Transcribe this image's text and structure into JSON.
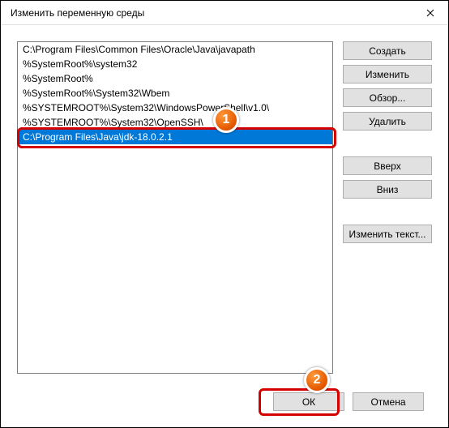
{
  "window": {
    "title": "Изменить переменную среды"
  },
  "list": {
    "items": [
      "C:\\Program Files\\Common Files\\Oracle\\Java\\javapath",
      "%SystemRoot%\\system32",
      "%SystemRoot%",
      "%SystemRoot%\\System32\\Wbem",
      "%SYSTEMROOT%\\System32\\WindowsPowerShell\\v1.0\\",
      "%SYSTEMROOT%\\System32\\OpenSSH\\"
    ],
    "editing_value": "C:\\Program Files\\Java\\jdk-18.0.2.1"
  },
  "buttons": {
    "create": "Создать",
    "edit": "Изменить",
    "browse": "Обзор...",
    "delete": "Удалить",
    "up": "Вверх",
    "down": "Вниз",
    "edit_text": "Изменить текст...",
    "ok": "ОК",
    "cancel": "Отмена"
  },
  "annotations": {
    "step1": "1",
    "step2": "2"
  }
}
